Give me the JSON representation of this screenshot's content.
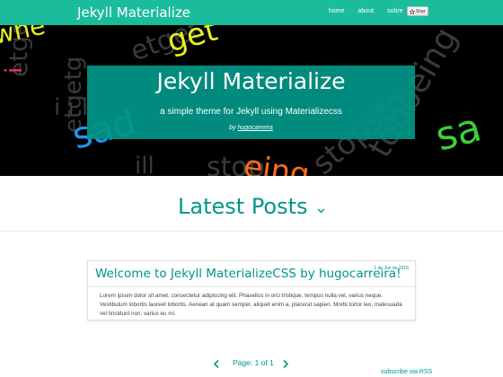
{
  "navbar": {
    "brand": "Jekyll Materialize",
    "links": [
      "home",
      "about",
      "sobre"
    ],
    "star_label": "Star",
    "color": "#1abc9c"
  },
  "hero": {
    "title": "Jekyll Materialize",
    "subtitle": "a simple theme for Jekyll using Materializecss",
    "author_prefix": "by",
    "author": "hugocarreira",
    "box_color": "#009688"
  },
  "section": {
    "title": "Latest Posts"
  },
  "post": {
    "title": "Welcome to Jekyll MaterializeCSS by hugocarreira!",
    "date": "1 de Jun de 2016",
    "excerpt": "Lorem ipsum dolor sit amet, consectetur adipiscing elit. Phasellus in orci tristique, tempus nulla vel, varius neque. Vestibulum lobortis laoreet lobortis. Aenean at quam semper, aliquet enim a, placerat sapien. Morbi tortor leo, malesuada vel tincidunt non, varius eu mi."
  },
  "pagination": {
    "label": "Page: 1 of 1"
  },
  "footer": {
    "rss": "subscribe via RSS"
  },
  "icons": [
    "star-icon",
    "chevron-down-icon",
    "chevron-left-icon",
    "chevron-right-icon"
  ],
  "accent": "#009688"
}
